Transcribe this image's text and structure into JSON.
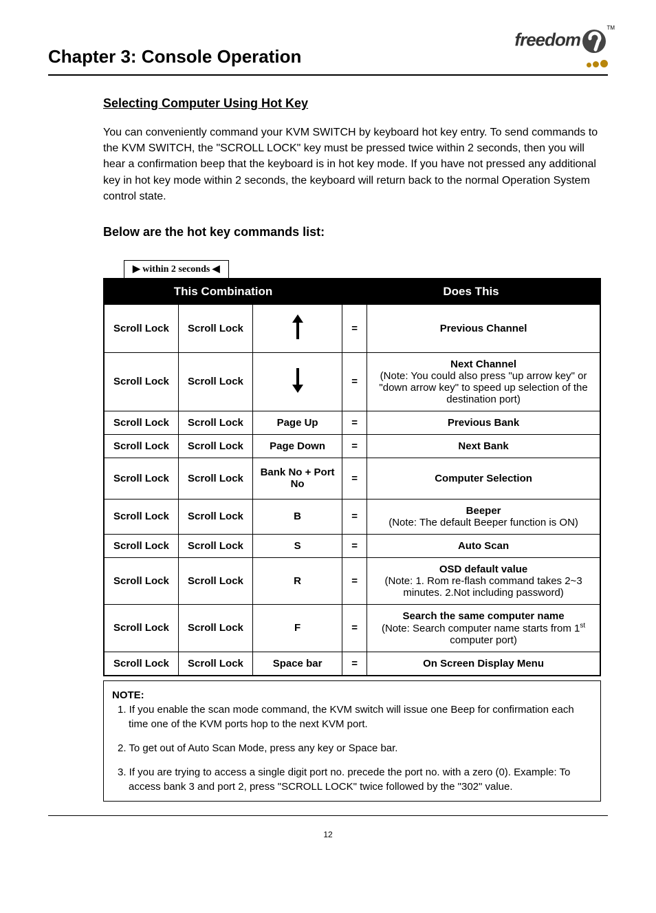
{
  "header": {
    "chapter_title": "Chapter 3: Console Operation",
    "logo_text": "freedom",
    "logo_tm": "TM"
  },
  "section": {
    "title": "Selecting Computer Using Hot Key",
    "intro": "You can conveniently command your KVM SWITCH by keyboard hot key entry. To send commands to the KVM SWITCH, the \"SCROLL LOCK\" key must be pressed twice within 2 seconds, then you will hear a confirmation beep that the keyboard is in hot key mode. If you have not pressed any additional key in hot key mode within 2 seconds, the keyboard will return back to the normal Operation System control state.",
    "sub_title": "Below are the hot key commands list:",
    "within_label": "within 2 seconds"
  },
  "table": {
    "header_left": "This Combination",
    "header_right": "Does This",
    "eq": "=",
    "scroll_lock": "Scroll Lock",
    "rows": [
      {
        "key3": "__ARROW_UP__",
        "does_bold": "Previous Channel",
        "does_note": ""
      },
      {
        "key3": "__ARROW_DOWN__",
        "does_bold": "Next Channel",
        "does_note": "(Note: You could also press \"up arrow key\" or \"down arrow key\" to speed up selection of the destination port)"
      },
      {
        "key3": "Page Up",
        "does_bold": "Previous Bank",
        "does_note": ""
      },
      {
        "key3": "Page Down",
        "does_bold": "Next Bank",
        "does_note": ""
      },
      {
        "key3": "Bank No + Port No",
        "does_bold": "Computer Selection",
        "does_note": ""
      },
      {
        "key3": "B",
        "does_bold": "Beeper",
        "does_note": "(Note: The default Beeper function is ON)"
      },
      {
        "key3": "S",
        "does_bold": "Auto Scan",
        "does_note": ""
      },
      {
        "key3": "R",
        "does_bold": "OSD default value",
        "does_note": "(Note: 1. Rom re-flash command takes 2~3 minutes. 2.Not including password)"
      },
      {
        "key3": "F",
        "does_bold": "Search the same computer name",
        "does_note": "(Note: Search computer name starts from 1st computer port)"
      },
      {
        "key3": "Space bar",
        "does_bold": "On Screen Display Menu",
        "does_note": ""
      }
    ]
  },
  "notes": {
    "title": "NOTE:",
    "items": [
      "1. If you enable the scan mode command, the KVM switch will issue one Beep for confirmation each time one of the KVM ports hop to the next KVM port.",
      "2. To get out of Auto Scan Mode, press any key or Space bar.",
      "3. If you are trying to access a single digit port no. precede the port no. with a zero (0). Example: To access bank 3 and port 2, press \"SCROLL LOCK\" twice followed by the \"302\" value."
    ]
  },
  "page_number": "12"
}
